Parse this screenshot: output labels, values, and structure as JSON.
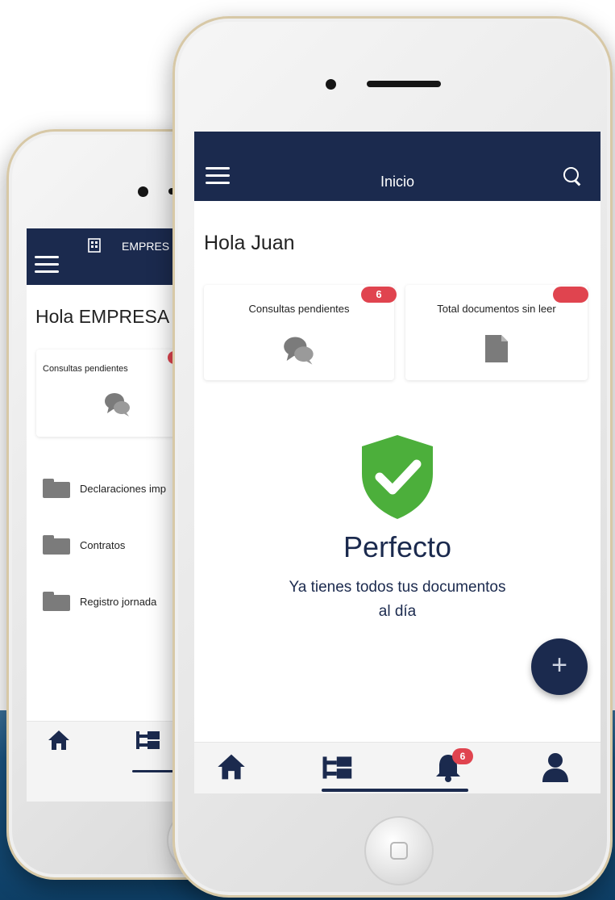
{
  "colors": {
    "navy": "#1b2a4e",
    "badge_red": "#e0444f",
    "success_green": "#4caf3b",
    "icon_gray": "#7b7b7b"
  },
  "back_phone": {
    "appbar": {
      "icon": "building-icon",
      "title": "EMPRES"
    },
    "greeting": "Hola EMPRESA",
    "card_consultas": {
      "label": "Consultas pendientes",
      "icon": "chat-bubbles-icon"
    },
    "folders": [
      {
        "label": "Declaraciones imp",
        "icon": "folder-icon"
      },
      {
        "label": "Contratos",
        "icon": "folder-icon"
      },
      {
        "label": "Registro jornada",
        "icon": "folder-icon"
      }
    ],
    "tabs": [
      {
        "icon": "home-icon"
      },
      {
        "icon": "tree-structure-icon"
      }
    ]
  },
  "front_phone": {
    "appbar": {
      "title": "Inicio",
      "menu_icon": "hamburger-menu-icon",
      "search_icon": "search-icon"
    },
    "greeting": "Hola Juan",
    "cards": [
      {
        "label": "Consultas pendientes",
        "badge": "6",
        "icon": "chat-bubbles-icon"
      },
      {
        "label": "Total documentos sin leer",
        "badge": "",
        "icon": "document-icon"
      }
    ],
    "status": {
      "icon": "shield-check-icon",
      "title": "Perfecto",
      "message_line1": "Ya tienes todos tus documentos",
      "message_line2": "al día"
    },
    "fab": {
      "label": "+",
      "icon": "plus-icon"
    },
    "tabs": [
      {
        "icon": "home-icon"
      },
      {
        "icon": "tree-structure-icon"
      },
      {
        "icon": "bell-icon",
        "badge": "6"
      },
      {
        "icon": "user-icon"
      }
    ]
  }
}
